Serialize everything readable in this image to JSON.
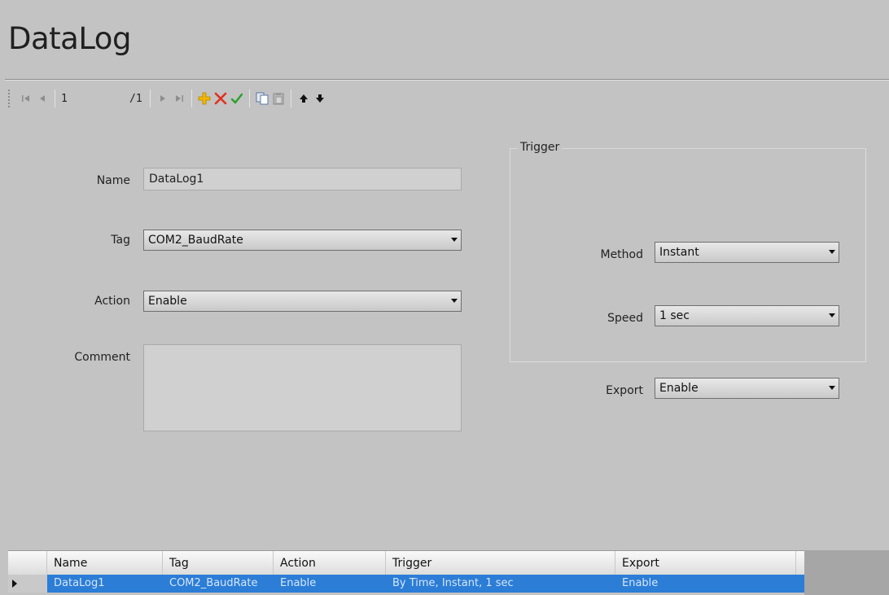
{
  "window": {
    "title": "DataLog"
  },
  "toolbar": {
    "position_value": "1",
    "position_total": "/1",
    "icons": [
      "first-record-icon",
      "prev-record-icon",
      "next-record-icon",
      "last-record-icon",
      "add-icon",
      "delete-icon",
      "apply-icon",
      "copy-icon",
      "paste-icon",
      "move-up-icon",
      "move-down-icon"
    ]
  },
  "form": {
    "name_label": "Name",
    "name_value": "DataLog1",
    "tag_label": "Tag",
    "tag_value": "COM2_BaudRate",
    "action_label": "Action",
    "action_value": "Enable",
    "comment_label": "Comment",
    "comment_value": ""
  },
  "trigger": {
    "group_title": "Trigger",
    "method_label": "Method",
    "method_value": "Instant",
    "speed_label": "Speed",
    "speed_value": "1 sec"
  },
  "export": {
    "label": "Export",
    "value": "Enable"
  },
  "grid": {
    "columns": [
      "Name",
      "Tag",
      "Action",
      "Trigger",
      "Export"
    ],
    "rows": [
      {
        "name": "DataLog1",
        "tag": "COM2_BaudRate",
        "action": "Enable",
        "trigger": "By Time, Instant, 1 sec",
        "export": "Enable"
      }
    ]
  },
  "colors": {
    "background": "#c3c3c3",
    "selection": "#2b7dd6",
    "add": "#f2b600",
    "delete": "#e03020",
    "apply": "#2aa02a"
  }
}
